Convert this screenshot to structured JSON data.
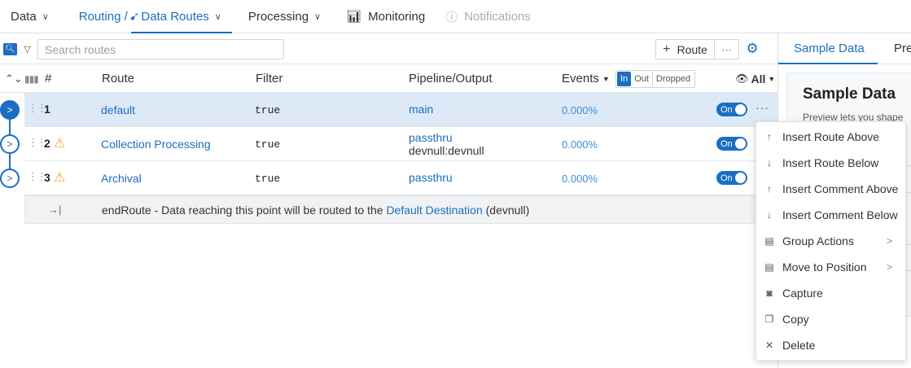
{
  "nav": {
    "data": "Data",
    "routing": "Routing / ",
    "data_routes": "Data Routes",
    "processing": "Processing",
    "monitoring": "Monitoring",
    "notifications": "Notifications"
  },
  "toolbar": {
    "search_placeholder": "Search routes",
    "route_label": "Route",
    "more_label": "···"
  },
  "table": {
    "col_num": "#",
    "col_route": "Route",
    "col_filter": "Filter",
    "col_pipeline": "Pipeline/Output",
    "col_events": "Events",
    "seg_in": "In",
    "seg_out": "Out",
    "seg_dropped": "Dropped",
    "col_all": "All"
  },
  "rows": [
    {
      "num": "1",
      "name": "default",
      "filter": "true",
      "pipeline": "main",
      "output": "",
      "events": "0.000%",
      "toggle": "On",
      "warning": false
    },
    {
      "num": "2",
      "name": "Collection Processing",
      "filter": "true",
      "pipeline": "passthru",
      "output": "devnull:devnull",
      "events": "0.000%",
      "toggle": "On",
      "warning": true
    },
    {
      "num": "3",
      "name": "Archival",
      "filter": "true",
      "pipeline": "passthru",
      "output": "",
      "events": "0.000%",
      "toggle": "On",
      "warning": true
    }
  ],
  "end_route": {
    "prefix": "endRoute - Data reaching this point will be routed to the ",
    "link": "Default Destination",
    "suffix": " (devnull)"
  },
  "side": {
    "tab_sample": "Sample Data",
    "tab_preview": "Pre",
    "title": "Sample Data",
    "desc": "Preview lets you shape"
  },
  "menu": [
    {
      "label": "Insert Route Above",
      "icon": "↑",
      "submenu": false
    },
    {
      "label": "Insert Route Below",
      "icon": "↓",
      "submenu": false
    },
    {
      "label": "Insert Comment Above",
      "icon": "↑",
      "submenu": false
    },
    {
      "label": "Insert Comment Below",
      "icon": "↓",
      "submenu": false
    },
    {
      "label": "Group Actions",
      "icon": "▤",
      "submenu": true
    },
    {
      "label": "Move to Position",
      "icon": "▤",
      "submenu": true
    },
    {
      "label": "Capture",
      "icon": "◙",
      "submenu": false
    },
    {
      "label": "Copy",
      "icon": "❐",
      "submenu": false
    },
    {
      "label": "Delete",
      "icon": "✕",
      "submenu": false
    }
  ],
  "colors": {
    "accent": "#1b6ec2",
    "warning": "#f0a22e",
    "selected_row": "#dde9f6"
  }
}
